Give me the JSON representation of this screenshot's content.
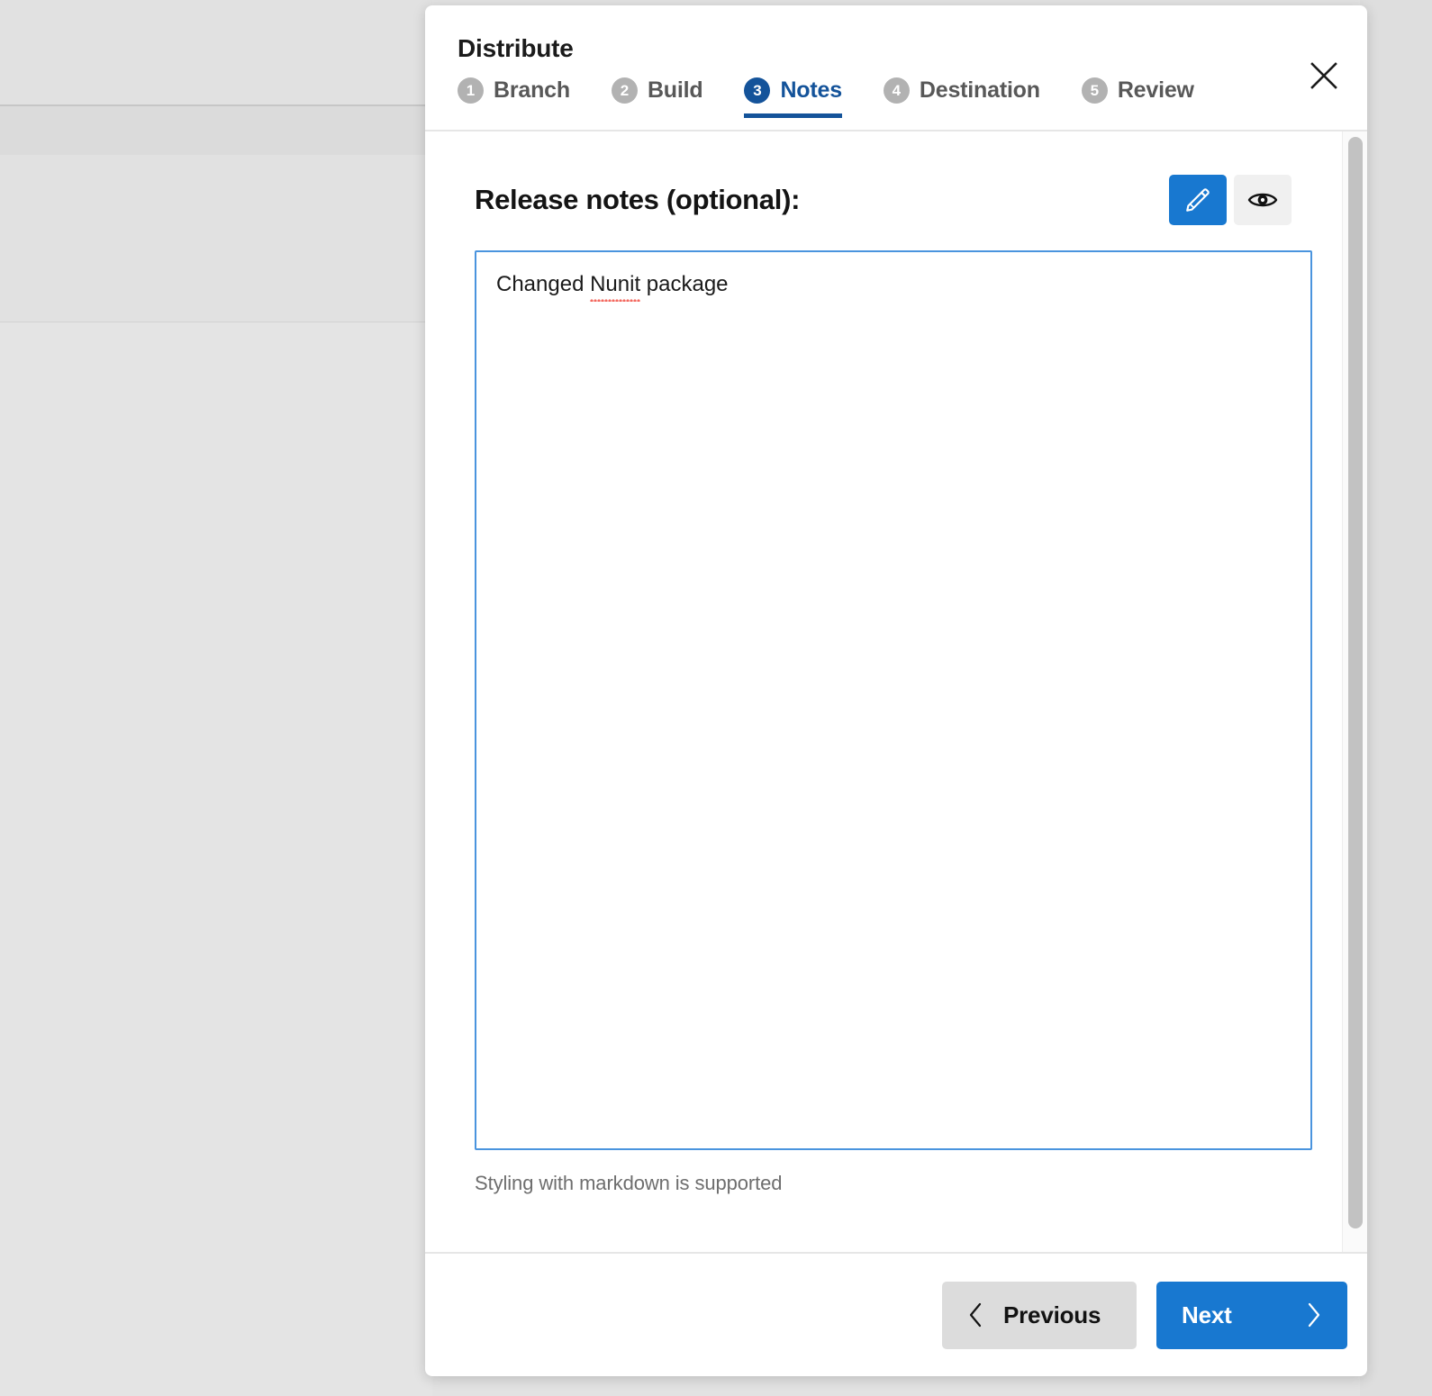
{
  "modal": {
    "title": "Distribute",
    "close_icon": "close-icon",
    "steps": [
      {
        "number": "1",
        "label": "Branch",
        "active": false
      },
      {
        "number": "2",
        "label": "Build",
        "active": false
      },
      {
        "number": "3",
        "label": "Notes",
        "active": true
      },
      {
        "number": "4",
        "label": "Destination",
        "active": false
      },
      {
        "number": "5",
        "label": "Review",
        "active": false
      }
    ]
  },
  "notes": {
    "heading": "Release notes (optional):",
    "edit_icon": "pencil-icon",
    "preview_icon": "eye-icon",
    "textarea_value": "Changed Nunit package",
    "textarea_value_prefix": "Changed ",
    "textarea_misspelled_word": "Nunit",
    "textarea_value_suffix": " package",
    "textarea_placeholder": "",
    "hint": "Styling with markdown is supported"
  },
  "footer": {
    "previous_label": "Previous",
    "previous_icon": "chevron-left-icon",
    "next_label": "Next",
    "next_icon": "chevron-right-icon"
  },
  "colors": {
    "accent_blue": "#1878d0",
    "active_step_blue": "#14539a",
    "textarea_border": "#4a94de",
    "muted_gray": "#6e6e6e",
    "spellcheck_red": "#f4685f"
  }
}
